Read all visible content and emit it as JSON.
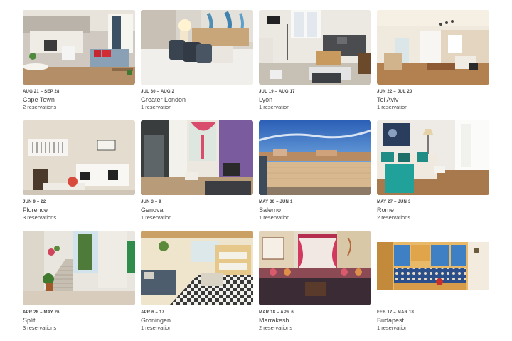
{
  "trips": [
    {
      "dates": "AUG 21 – SEP 28",
      "city": "Cape Town",
      "reservations": "2 reservations",
      "photo": "kitchen-living-room-photo"
    },
    {
      "dates": "JUL 30 – AUG 2",
      "city": "Greater London",
      "reservations": "1 reservation",
      "photo": "bedroom-photo"
    },
    {
      "dates": "JUL 19 – AUG 17",
      "city": "Lyon",
      "reservations": "1 reservation",
      "photo": "living-room-sofa-photo"
    },
    {
      "dates": "JUN 22 – JUL 20",
      "city": "Tel Aviv",
      "reservations": "1 reservation",
      "photo": "bright-living-room-photo"
    },
    {
      "dates": "JUN 9 – 22",
      "city": "Florence",
      "reservations": "3 reservations",
      "photo": "white-sofa-room-photo"
    },
    {
      "dates": "JUN 3 – 9",
      "city": "Genova",
      "reservations": "1 reservation",
      "photo": "purple-wall-room-photo"
    },
    {
      "dates": "MAY 30 – JUN 1",
      "city": "Salerno",
      "reservations": "1 reservation",
      "photo": "rooftop-terrace-photo"
    },
    {
      "dates": "MAY 27 – JUN 3",
      "city": "Rome",
      "reservations": "2 reservations",
      "photo": "teal-sofa-room-photo"
    },
    {
      "dates": "APR 28 – MAY 26",
      "city": "Split",
      "reservations": "3 reservations",
      "photo": "courtyard-stairs-photo"
    },
    {
      "dates": "APR 6 – 17",
      "city": "Groningen",
      "reservations": "1 reservation",
      "photo": "checkered-floor-room-photo"
    },
    {
      "dates": "MAR 18 – APR 6",
      "city": "Marrakesh",
      "reservations": "2 reservations",
      "photo": "moroccan-lounge-photo"
    },
    {
      "dates": "FEB 17 – MAR 18",
      "city": "Budapest",
      "reservations": "1 reservation",
      "photo": "tiled-kitchen-photo"
    }
  ]
}
